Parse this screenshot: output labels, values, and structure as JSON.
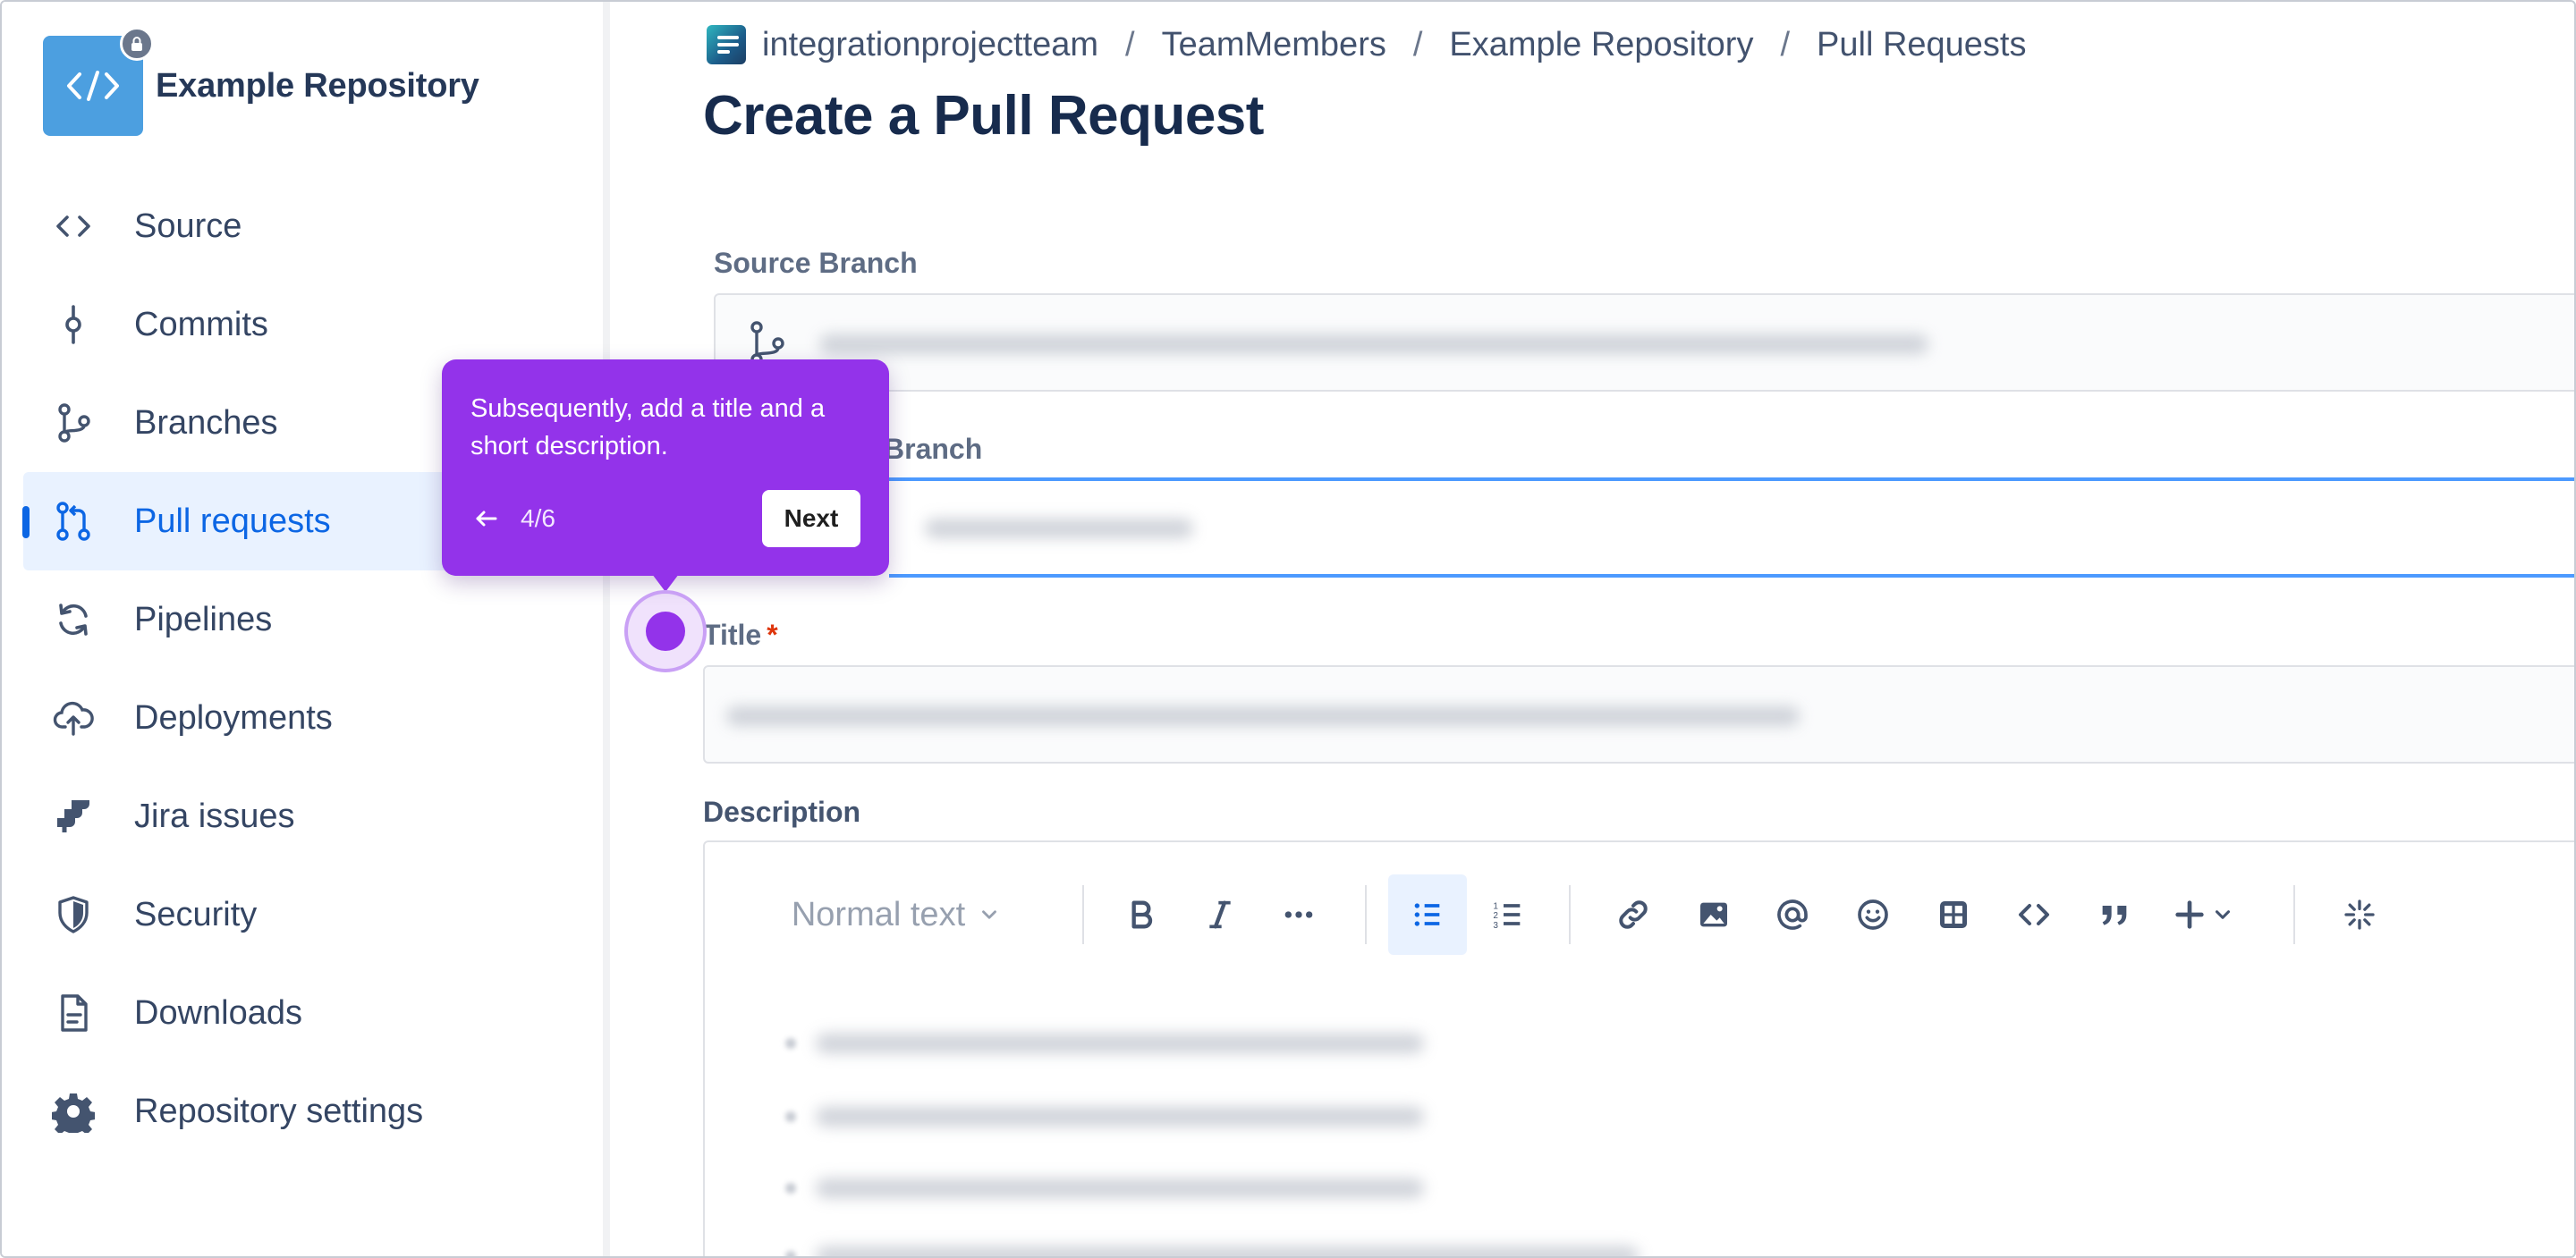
{
  "repo": {
    "name": "Example Repository"
  },
  "sidebar": {
    "items": [
      {
        "label": "Source",
        "icon": "code-icon"
      },
      {
        "label": "Commits",
        "icon": "commit-icon"
      },
      {
        "label": "Branches",
        "icon": "branch-icon"
      },
      {
        "label": "Pull requests",
        "icon": "pull-request-icon",
        "active": true
      },
      {
        "label": "Pipelines",
        "icon": "refresh-icon"
      },
      {
        "label": "Deployments",
        "icon": "cloud-upload-icon"
      },
      {
        "label": "Jira issues",
        "icon": "jira-icon"
      },
      {
        "label": "Security",
        "icon": "shield-icon"
      },
      {
        "label": "Downloads",
        "icon": "document-icon"
      },
      {
        "label": "Repository settings",
        "icon": "gear-icon"
      }
    ]
  },
  "breadcrumb": {
    "items": [
      "integrationprojectteam",
      "TeamMembers",
      "Example Repository",
      "Pull Requests"
    ],
    "separator": "/"
  },
  "page": {
    "title": "Create a Pull Request"
  },
  "form": {
    "source_branch_label": "Source Branch",
    "destination_branch_label": "Branch",
    "title_label": "Title",
    "title_required_mark": "*",
    "description_label": "Description"
  },
  "editor": {
    "text_style": "Normal text",
    "toolbar_icons": [
      "bold-icon",
      "italic-icon",
      "more-icon",
      "bullet-list-icon",
      "numbered-list-icon",
      "link-icon",
      "image-icon",
      "mention-icon",
      "emoji-icon",
      "table-icon",
      "code-icon",
      "quote-icon",
      "insert-icon",
      "ai-icon"
    ]
  },
  "tooltip": {
    "text": "Subsequently, add a title and a short description.",
    "step": "4/6",
    "next_label": "Next"
  },
  "colors": {
    "accent": "#9333ea",
    "active_nav": "#0c66e4",
    "repo_avatar": "#4c9fe0",
    "focus_border": "#4c9aff"
  }
}
